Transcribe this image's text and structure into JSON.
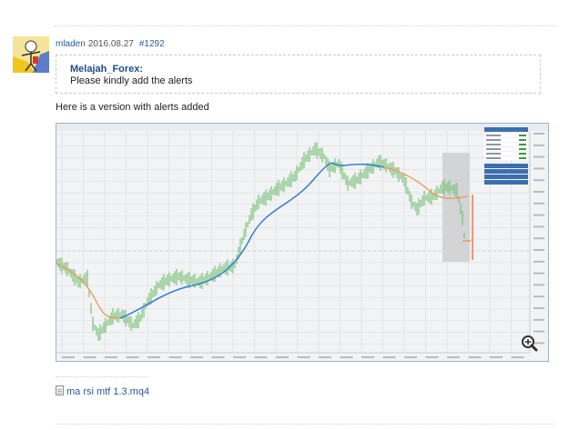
{
  "post": {
    "author": "mladen",
    "date": "2016.08.27",
    "permalink": "#1292",
    "quote": {
      "author": "Melajah_Forex:",
      "text": "Please kindly add the alerts"
    },
    "body_text": "Here is a version with alerts added"
  },
  "chart": {
    "info_panel": {
      "rows": [
        "EURUSD",
        "range",
        "change",
        "distance from high",
        "distance from low",
        "spread"
      ],
      "buttons": [
        "Hide swaps",
        "Hide candle",
        "Hide aspect",
        "Hide swap"
      ]
    },
    "zoom_icon": "magnifier-plus-icon",
    "colors": {
      "price_bars": "#7cc27c",
      "ma_line_up": "#2a78d6",
      "ma_line_down": "#f0965a",
      "alert_line": "#f07a45",
      "panel_header": "#3d6fb0"
    }
  },
  "attachment": {
    "icon": "file-icon",
    "filename": "ma rsi mtf 1.3.mq4"
  }
}
